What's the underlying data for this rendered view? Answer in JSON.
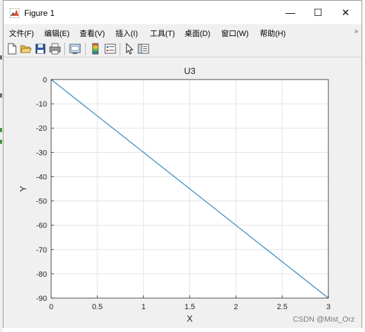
{
  "window": {
    "title": "Figure 1",
    "controls": {
      "minimize": "—",
      "maximize": "☐",
      "close": "✕"
    }
  },
  "menu": {
    "items": [
      "文件(F)",
      "编辑(E)",
      "查看(V)",
      "插入(I)",
      "工具(T)",
      "桌面(D)",
      "窗口(W)",
      "帮助(H)"
    ],
    "overflow": "»"
  },
  "toolbar": {
    "buttons": [
      "new-file-icon",
      "open-folder-icon",
      "save-icon",
      "print-icon",
      "print-preview-icon",
      "colorbar-icon",
      "legend-icon",
      "pointer-icon",
      "property-editor-icon"
    ]
  },
  "colors": {
    "line": "#2f86c0",
    "axes_bg": "#ffffff",
    "grid": "#e3e3e3",
    "figure_bg": "#f0f0f0"
  },
  "chart_data": {
    "type": "line",
    "title": "U3",
    "xlabel": "X",
    "ylabel": "Y",
    "xlim": [
      0,
      3
    ],
    "ylim": [
      -90,
      0
    ],
    "xticks": [
      0,
      0.5,
      1,
      1.5,
      2,
      2.5,
      3
    ],
    "yticks": [
      0,
      -10,
      -20,
      -30,
      -40,
      -50,
      -60,
      -70,
      -80,
      -90
    ],
    "xtick_labels": [
      "0",
      "0.5",
      "1",
      "1.5",
      "2",
      "2.5",
      "3"
    ],
    "ytick_labels": [
      "0",
      "-10",
      "-20",
      "-30",
      "-40",
      "-50",
      "-60",
      "-70",
      "-80",
      "-90"
    ],
    "grid": true,
    "series": [
      {
        "x": [
          0,
          3
        ],
        "y": [
          0,
          -90
        ]
      }
    ]
  },
  "watermark": "CSDN @Mist_Orz"
}
